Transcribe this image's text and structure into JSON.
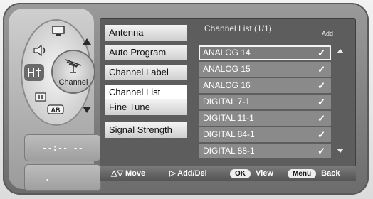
{
  "side_icons": [
    "monitor-icon",
    "speaker-icon",
    "pip-icon",
    "channel-antenna-icon",
    "input-icon",
    "ab-icon"
  ],
  "channel_icon_label": "Channel",
  "lcd": {
    "top_text": "--:-- --",
    "bottom_text": "--. -- ----"
  },
  "menu": {
    "items": [
      {
        "label": "Antenna"
      },
      {
        "label": "Auto Program"
      },
      {
        "label": "Channel Label"
      },
      {
        "label": "Channel List"
      },
      {
        "label": "Fine Tune"
      },
      {
        "label": "Signal Strength"
      }
    ],
    "selected": "Channel List"
  },
  "channel_list": {
    "title": "Channel List (1/1)",
    "add_header": "Add",
    "check_glyph": "✓",
    "rows": [
      {
        "name": "ANALOG 14",
        "highlighted": true
      },
      {
        "name": "ANALOG 15"
      },
      {
        "name": "ANALOG 16"
      },
      {
        "name": "DIGITAL 7-1"
      },
      {
        "name": "DIGITAL 11-1"
      },
      {
        "name": "DIGITAL 84-1"
      },
      {
        "name": "DIGITAL 88-1"
      }
    ]
  },
  "help": {
    "move_glyph": "△▽",
    "move": "Move",
    "adddel_glyph": "▷",
    "adddel": "Add/Del",
    "ok_key": "OK",
    "view": "View",
    "menu_key": "Menu",
    "back": "Back"
  }
}
